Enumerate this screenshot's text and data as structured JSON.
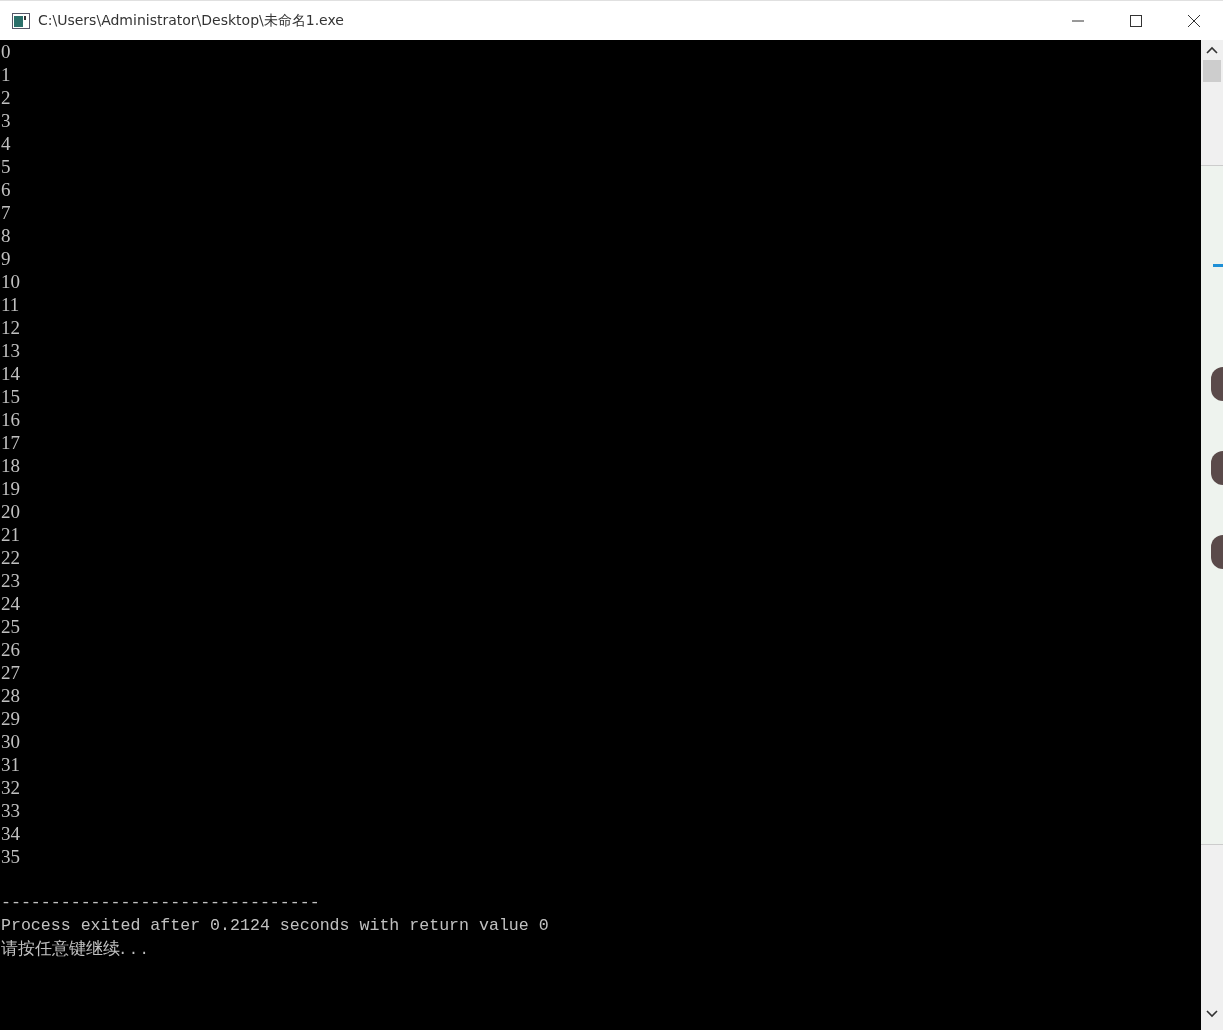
{
  "window": {
    "title": "C:\\Users\\Administrator\\Desktop\\未命名1.exe"
  },
  "console": {
    "lines": [
      "0",
      "1",
      "2",
      "3",
      "4",
      "5",
      "6",
      "7",
      "8",
      "9",
      "10",
      "11",
      "12",
      "13",
      "14",
      "15",
      "16",
      "17",
      "18",
      "19",
      "20",
      "21",
      "22",
      "23",
      "24",
      "25",
      "26",
      "27",
      "28",
      "29",
      "30",
      "31",
      "32",
      "33",
      "34",
      "35"
    ],
    "separator": "--------------------------------",
    "message": "Process exited after 0.2124 seconds with return value 0",
    "prompt": "请按任意键继续. . ."
  }
}
